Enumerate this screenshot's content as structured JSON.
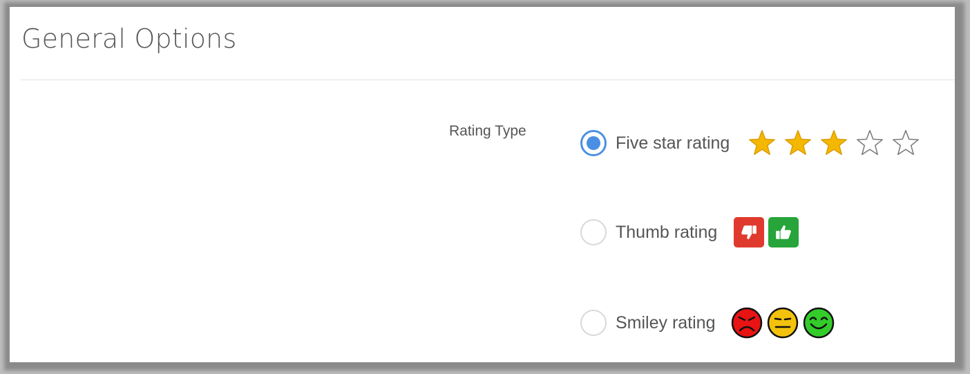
{
  "section": {
    "title": "General Options"
  },
  "rating_type": {
    "label": "Rating Type",
    "selected": "five_star",
    "options": [
      {
        "id": "five_star",
        "label": "Five star rating",
        "selected": true,
        "preview": {
          "filled_stars": 3,
          "total_stars": 5,
          "fill_color": "#f5b800",
          "empty_color": "#7a7a7a"
        }
      },
      {
        "id": "thumb",
        "label": "Thumb rating",
        "selected": false,
        "preview": {
          "icons": [
            "thumb-down-icon",
            "thumb-up-icon"
          ],
          "colors": [
            "#e03a2e",
            "#27a53a"
          ]
        }
      },
      {
        "id": "smiley",
        "label": "Smiley rating",
        "selected": false,
        "preview": {
          "icons": [
            "angry-face-icon",
            "neutral-face-icon",
            "happy-face-icon"
          ],
          "colors": [
            "#e81313",
            "#f3c20c",
            "#33cc2a"
          ]
        }
      }
    ]
  },
  "colors": {
    "accent": "#4a8fe3"
  }
}
